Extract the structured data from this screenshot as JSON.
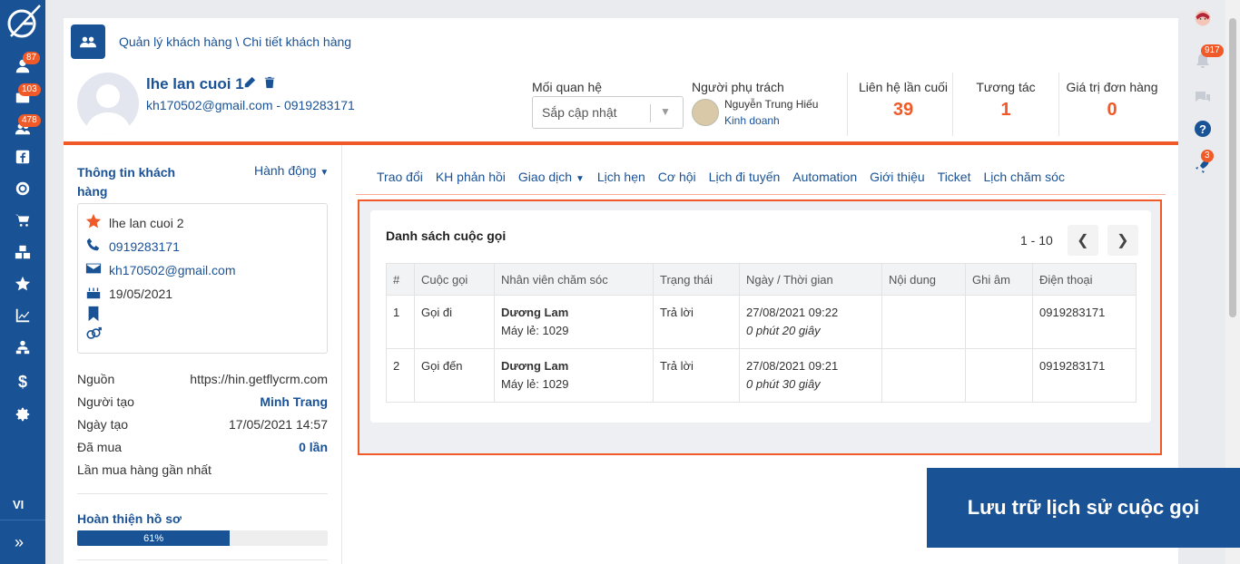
{
  "sidebar": {
    "badges": [
      "87",
      "103",
      "478"
    ],
    "lang": "VI",
    "icons": [
      "user-icon",
      "mail-icon",
      "users-icon",
      "facebook-icon",
      "target-icon",
      "cart-icon",
      "boxes-icon",
      "star-icon",
      "chart-icon",
      "user-group-icon",
      "dollar-icon",
      "gear-icon"
    ]
  },
  "rightrail": {
    "notif_badge": "917",
    "rocket_badge": "3"
  },
  "breadcrumb": "Quản lý khách hàng \\ Chi tiết khách hàng",
  "customer": {
    "name": "lhe lan cuoi 1",
    "contact": "kh170502@gmail.com - 0919283171"
  },
  "relationship": {
    "label": "Mối quan hệ",
    "value": "Sắp cập nhật"
  },
  "owner": {
    "label": "Người phụ trách",
    "name": "Nguyễn Trung Hiếu",
    "role": "Kinh doanh"
  },
  "stats": [
    {
      "label": "Liên hệ lần cuối",
      "value": "39"
    },
    {
      "label": "Tương tác",
      "value": "1"
    },
    {
      "label": "Giá trị đơn hàng",
      "value": "0"
    }
  ],
  "left_panel": {
    "title": "Thông tin khách hàng",
    "action": "Hành động",
    "info": {
      "alt_name": "lhe lan cuoi 2",
      "phone": "0919283171",
      "email": "kh170502@gmail.com",
      "birthday": "19/05/2021"
    },
    "meta": [
      {
        "label": "Nguồn",
        "value": "https://hin.getflycrm.com",
        "bold": false
      },
      {
        "label": "Người tạo",
        "value": "Minh Trang",
        "bold": true
      },
      {
        "label": "Ngày tạo",
        "value": "17/05/2021 14:57",
        "bold": false
      },
      {
        "label": "Đã mua",
        "value": "0 lần",
        "bold": true
      },
      {
        "label": "Lần mua hàng gần nhất",
        "value": "",
        "bold": false
      }
    ],
    "profile_label": "Hoàn thiện hồ sơ",
    "profile_progress": 61,
    "profile_text": "61%"
  },
  "tabs": [
    "Trao đổi",
    "KH phản hồi",
    "Giao dịch",
    "Lịch hẹn",
    "Cơ hội",
    "Lịch đi tuyến",
    "Automation",
    "Giới thiệu",
    "Ticket",
    "Lịch chăm sóc"
  ],
  "calls": {
    "title": "Danh sách cuộc gọi",
    "pager": "1 - 10",
    "columns": [
      "#",
      "Cuộc gọi",
      "Nhân viên chăm sóc",
      "Trạng thái",
      "Ngày / Thời gian",
      "Nội dung",
      "Ghi âm",
      "Điện thoại"
    ],
    "rows": [
      {
        "no": "1",
        "type": "Gọi đi",
        "staff": "Dương Lam",
        "ext": "Máy lẻ: 1029",
        "status": "Trả lời",
        "datetime": "27/08/2021 09:22",
        "duration": "0 phút 20 giây",
        "content": "",
        "record": "",
        "phone": "0919283171"
      },
      {
        "no": "2",
        "type": "Gọi đến",
        "staff": "Dương Lam",
        "ext": "Máy lẻ: 1029",
        "status": "Trả lời",
        "datetime": "27/08/2021 09:21",
        "duration": "0 phút 30 giây",
        "content": "",
        "record": "",
        "phone": "0919283171"
      }
    ]
  },
  "caption": "Lưu trữ lịch sử cuộc gọi",
  "colors": {
    "brand": "#1a5296",
    "accent": "#f05a28"
  }
}
